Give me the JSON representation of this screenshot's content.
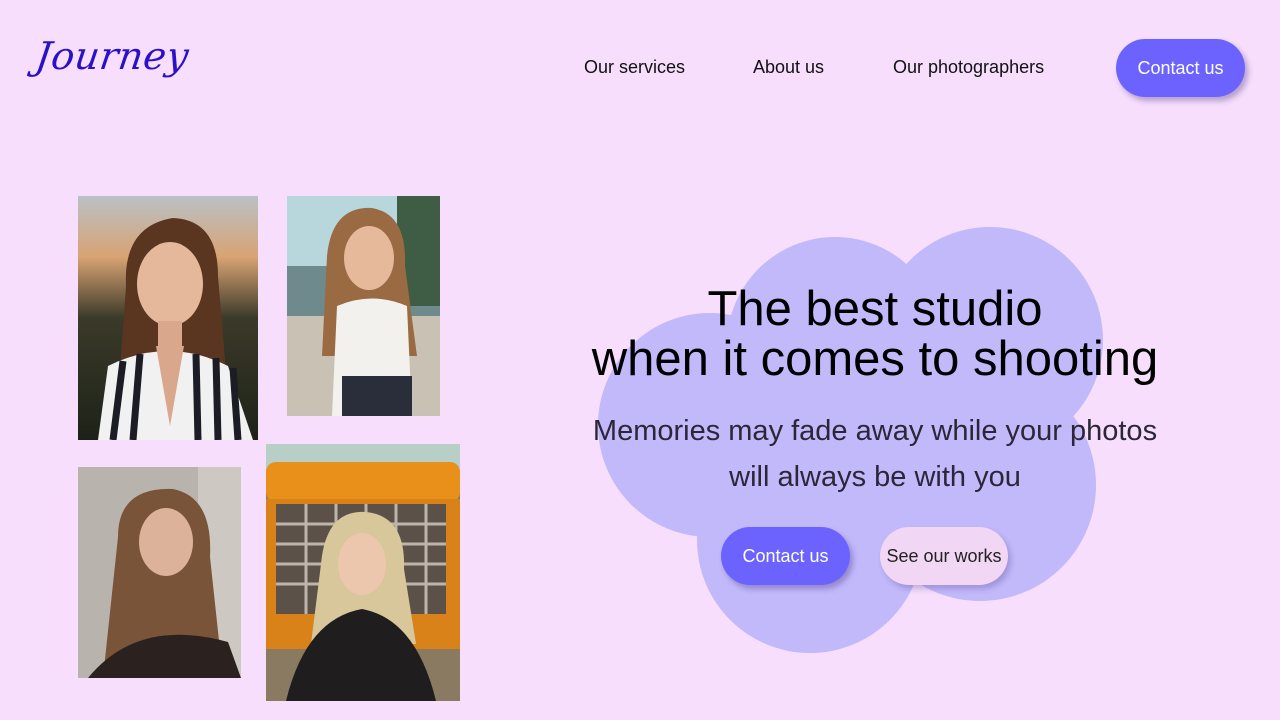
{
  "brand": {
    "logo_text": "Journey",
    "logo_color": "#2a10c8"
  },
  "nav": {
    "links": [
      {
        "label": "Our services"
      },
      {
        "label": "About us"
      },
      {
        "label": "Our photographers"
      }
    ],
    "contact_label": "Contact us"
  },
  "hero": {
    "title_line1": "The best studio",
    "title_line2": "when it comes to shooting",
    "subtitle_line1": "Memories may fade away while your photos",
    "subtitle_line2": "will always be with you",
    "primary_button": "Contact us",
    "secondary_button": "See our works"
  },
  "colors": {
    "background": "#f6defc",
    "accent": "#6c63ff",
    "blob": "#c2b9fb"
  },
  "gallery": {
    "photos": [
      {
        "name": "portrait-striped-shirt"
      },
      {
        "name": "portrait-white-top"
      },
      {
        "name": "portrait-dark-top"
      },
      {
        "name": "portrait-orange-truck"
      }
    ]
  }
}
